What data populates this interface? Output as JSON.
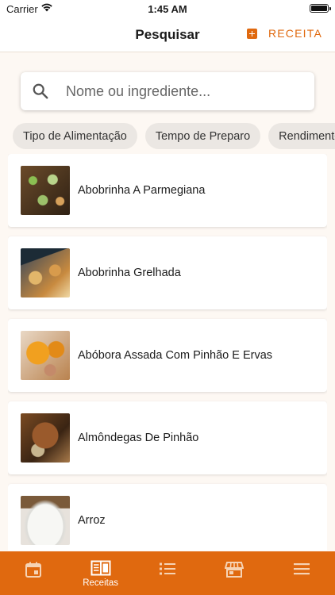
{
  "status_bar": {
    "carrier": "Carrier",
    "time": "1:45 AM"
  },
  "nav": {
    "title": "Pesquisar",
    "add_label": "RECEITA"
  },
  "search": {
    "placeholder": "Nome ou ingrediente...",
    "value": ""
  },
  "filters": [
    "Tipo de Alimentação",
    "Tempo de Preparo",
    "Rendimento"
  ],
  "recipes": [
    {
      "name": "Abobrinha A Parmegiana"
    },
    {
      "name": "Abobrinha Grelhada"
    },
    {
      "name": "Abóbora Assada Com Pinhão E Ervas"
    },
    {
      "name": "Almôndegas De Pinhão"
    },
    {
      "name": "Arroz"
    }
  ],
  "tab_bar": {
    "tabs": [
      {
        "icon": "calendar-icon",
        "label": ""
      },
      {
        "icon": "book-icon",
        "label": "Receitas",
        "active": true
      },
      {
        "icon": "list-icon",
        "label": ""
      },
      {
        "icon": "store-icon",
        "label": ""
      },
      {
        "icon": "menu-icon",
        "label": ""
      }
    ]
  },
  "colors": {
    "accent": "#e0690f",
    "background": "#fdf8f3"
  }
}
